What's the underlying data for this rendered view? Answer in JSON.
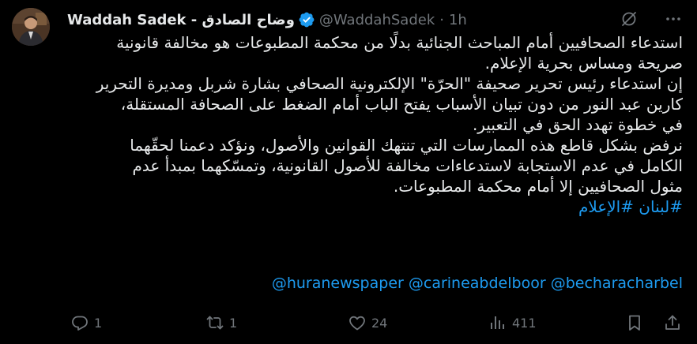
{
  "author": {
    "display_name": "Waddah Sadek - وضاح الصادق",
    "handle": "@WaddahSadek",
    "separator": "·",
    "timestamp": "1h"
  },
  "tweet": {
    "lines": [
      "استدعاء الصحافيين أمام المباحث الجنائية بدلًا من محكمة المطبوعات هو مخالفة قانونية",
      "صريحة ومساس بحرية الإعلام.",
      "إن استدعاء رئيس تحرير صحيفة \"الحرّة\" الإلكترونية الصحافي بشارة شربل ومديرة التحرير",
      "كارين عبد النور من دون تبيان الأسباب يفتح الباب أمام الضغط على الصحافة المستقلة،",
      "في خطوة تهدد الحق في التعبير.",
      "نرفض بشكل قاطع هذه الممارسات التي تنتهك القوانين والأصول، ونؤكد دعمنا لحقّهما",
      "الكامل في عدم الاستجابة لاستدعاءات مخالفة للأصول القانونية، وتمسّكهما بمبدأ عدم",
      "مثول الصحافيين إلا أمام محكمة المطبوعات."
    ],
    "hashtags": [
      "#لبنان",
      "#الإعلام"
    ],
    "mentions": [
      "@huranewspaper",
      "@carineabdelboor",
      "@becharacharbel"
    ]
  },
  "actions": {
    "replies": "1",
    "reposts": "1",
    "likes": "24",
    "views": "411"
  },
  "colors": {
    "background": "#000000",
    "text": "#e7e9ea",
    "muted": "#71767b",
    "accent": "#1d9bf0"
  },
  "icons": {
    "verified": "verified-badge-icon",
    "grok": "grok-icon",
    "more": "more-icon",
    "reply": "reply-icon",
    "repost": "repost-icon",
    "like": "heart-icon",
    "views": "views-icon",
    "bookmark": "bookmark-icon",
    "share": "share-icon"
  }
}
